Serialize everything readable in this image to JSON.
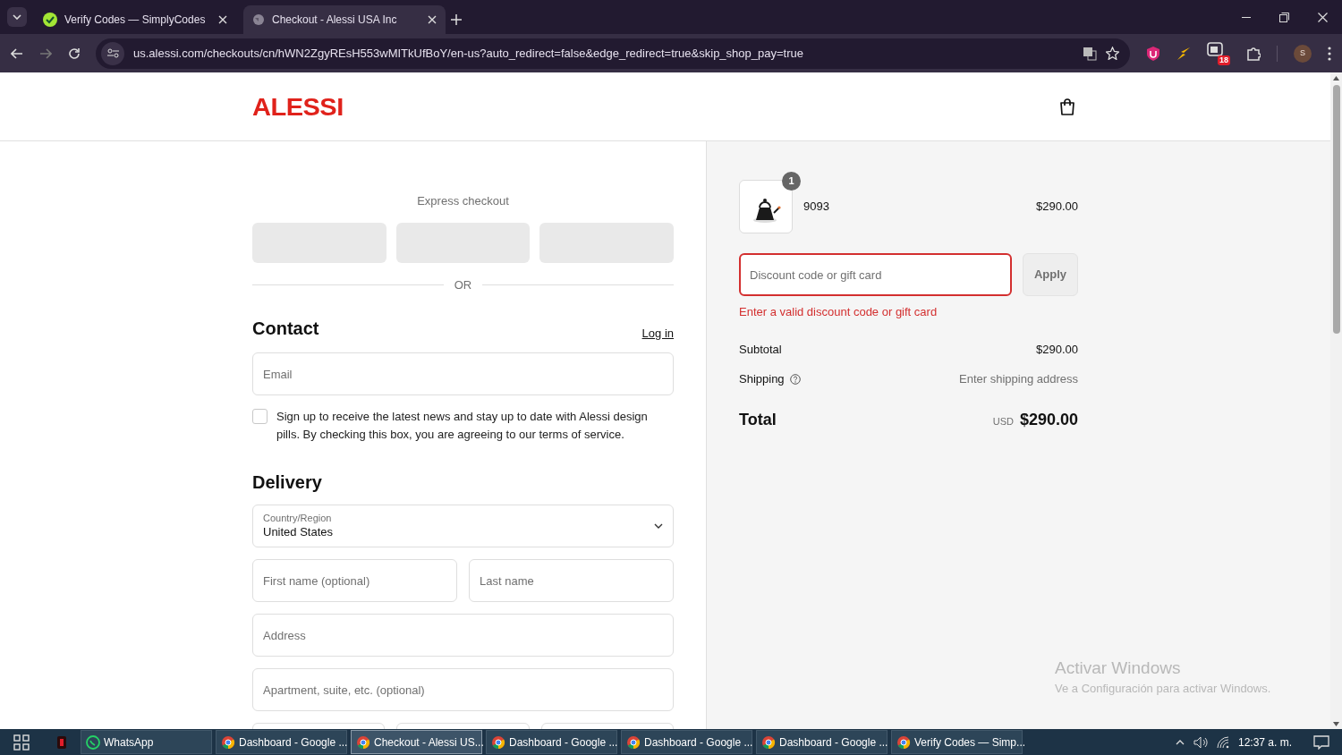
{
  "browser": {
    "tabs": [
      {
        "title": "Verify Codes — SimplyCodes",
        "selected": false,
        "kind": "simplycodes"
      },
      {
        "title": "Checkout - Alessi USA Inc",
        "selected": true,
        "kind": "globe"
      }
    ],
    "url": "us.alessi.com/checkouts/cn/hWN2ZgyREsH553wMITkUfBoY/en-us?auto_redirect=false&edge_redirect=true&skip_shop_pay=true",
    "extension_badge": "18",
    "profile_initial": "S"
  },
  "header": {
    "logo": "ALESSI"
  },
  "checkout": {
    "express_title": "Express checkout",
    "or": "OR",
    "contact": {
      "title": "Contact",
      "login": "Log in",
      "email_placeholder": "Email",
      "newsletter": {
        "text": "Sign up to receive the latest news and stay up to date with Alessi design pills. By checking this box, you are agreeing to our terms of service.",
        "checked": false
      }
    },
    "delivery": {
      "title": "Delivery",
      "country_label": "Country/Region",
      "country_value": "United States",
      "field_rows": [
        [
          {
            "placeholder": "First name (optional)"
          },
          {
            "placeholder": "Last name"
          }
        ],
        [
          {
            "placeholder": "Address"
          }
        ],
        [
          {
            "placeholder": "Apartment, suite, etc. (optional)"
          }
        ]
      ]
    }
  },
  "summary": {
    "item": {
      "quantity": "1",
      "name": "9093",
      "price": "$290.00"
    },
    "discount": {
      "placeholder": "Discount code or gift card",
      "error": "Enter a valid discount code or gift card",
      "button": "Apply"
    },
    "lines": [
      {
        "label": "Subtotal",
        "value": "$290.00",
        "kind": "amount"
      },
      {
        "label": "Shipping",
        "value": "Enter shipping address",
        "kind": "hint"
      }
    ],
    "total": {
      "label": "Total",
      "currency": "USD",
      "value": "$290.00"
    }
  },
  "activation": {
    "title": "Activar Windows",
    "text": "Ve a Configuración para activar Windows."
  },
  "taskbar": {
    "items": [
      {
        "label": "WhatsApp",
        "selected": false,
        "kind": "whatsapp"
      },
      {
        "label": "Dashboard - Google ...",
        "selected": false,
        "kind": "chrome"
      },
      {
        "label": "Checkout - Alessi US...",
        "selected": true,
        "kind": "chrome"
      },
      {
        "label": "Dashboard - Google ...",
        "selected": false,
        "kind": "chrome"
      },
      {
        "label": "Dashboard - Google ...",
        "selected": false,
        "kind": "chrome"
      },
      {
        "label": "Dashboard - Google ...",
        "selected": false,
        "kind": "chrome"
      },
      {
        "label": "Verify Codes — Simp...",
        "selected": false,
        "kind": "chrome"
      }
    ],
    "time": "12:37 a. m."
  }
}
